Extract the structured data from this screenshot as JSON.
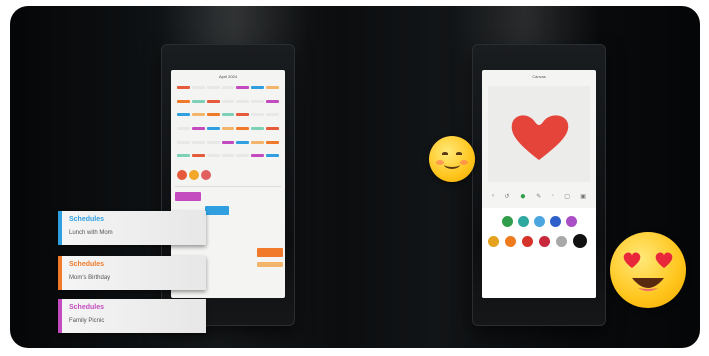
{
  "left_screen": {
    "title": "April 2024"
  },
  "cards": [
    {
      "title": "Schedules",
      "subtitle": "Lunch with Mom",
      "accent": "#2f9fe0"
    },
    {
      "title": "Schedules",
      "subtitle": "Mom's Birthday",
      "accent": "#f07a2a"
    },
    {
      "title": "Schedules",
      "subtitle": "Family Picnic",
      "accent": "#c44bbf"
    }
  ],
  "right_screen": {
    "title": "Canvas",
    "toolbar": [
      "‹",
      "↺",
      "●",
      "✎",
      "◦",
      "▢",
      "▣"
    ]
  },
  "palette_colors": [
    "#2f9d4a",
    "#2fa8a0",
    "#4ba6e0",
    "#2f5fc9",
    "#a94ec4",
    "#e4a21f",
    "#ef7b1d",
    "#d6332a",
    "#c7283c",
    "#a8a8a8",
    "#111111"
  ],
  "heart_color": "#e4443a",
  "emoji_left": "smiling-face",
  "emoji_right": "heart-eyes-face"
}
